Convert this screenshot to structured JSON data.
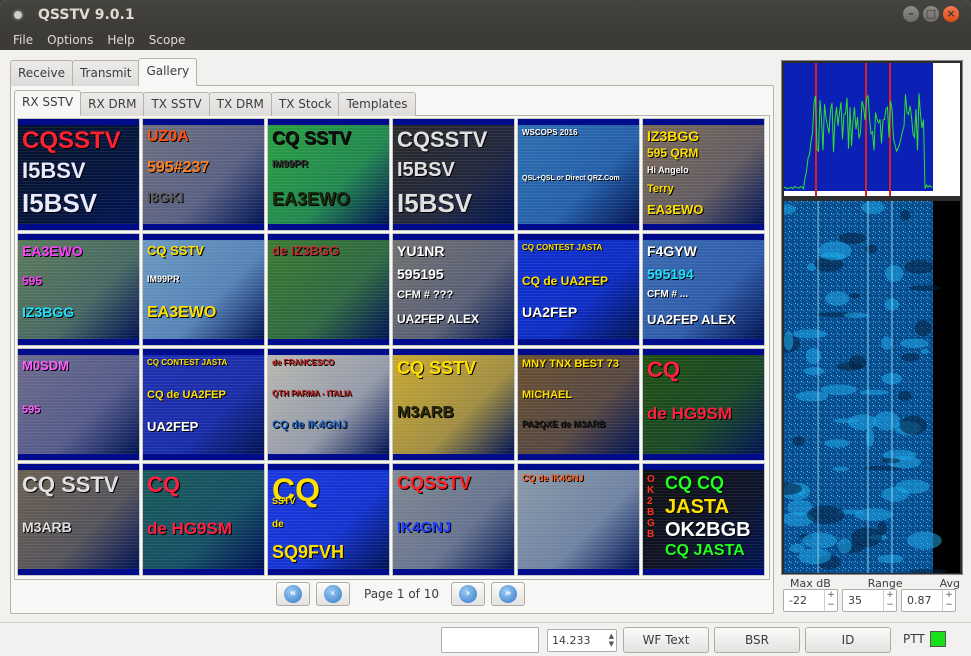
{
  "window": {
    "title": "QSSTV 9.0.1"
  },
  "menu": [
    "File",
    "Options",
    "Help",
    "Scope"
  ],
  "main_tabs": [
    {
      "label": "Receive"
    },
    {
      "label": "Transmit"
    },
    {
      "label": "Gallery",
      "active": true
    }
  ],
  "gallery_tabs": [
    {
      "label": "RX SSTV",
      "active": true
    },
    {
      "label": "RX DRM"
    },
    {
      "label": "TX SSTV"
    },
    {
      "label": "TX DRM"
    },
    {
      "label": "TX Stock"
    },
    {
      "label": "Templates"
    }
  ],
  "thumbnails": [
    {
      "bg": "#06122a",
      "lines": [
        {
          "t": "CQSSTV",
          "c": "#ff2030",
          "s": 24
        },
        {
          "t": "I5BSV",
          "c": "#e8e8ff",
          "s": 22
        },
        {
          "t": "I5BSV",
          "c": "#e8e8ff",
          "s": 26
        }
      ]
    },
    {
      "bg": "#6e7080",
      "lines": [
        {
          "t": "UZ0A",
          "c": "#ff5010",
          "s": 16
        },
        {
          "t": "595#237",
          "c": "#ff8020",
          "s": 16
        },
        {
          "t": "I8GKI",
          "c": "#5a5a5a",
          "s": 14
        }
      ]
    },
    {
      "bg": "#2aa040",
      "lines": [
        {
          "t": "CQ SSTV",
          "c": "#111",
          "s": 18
        },
        {
          "t": "IM99PR",
          "c": "#333",
          "s": 10
        },
        {
          "t": "EA3EWO",
          "c": "#1b2b10",
          "s": 18
        }
      ]
    },
    {
      "bg": "#2a2a2a",
      "lines": [
        {
          "t": "CQSSTV",
          "c": "#e0e0e0",
          "s": 22
        },
        {
          "t": "I5BSV",
          "c": "#e0e0e0",
          "s": 20
        },
        {
          "t": "I5BSV",
          "c": "#e0e0e0",
          "s": 26
        }
      ]
    },
    {
      "bg": "#2e6fb0",
      "lines": [
        {
          "t": "WSCOPS 2016",
          "c": "#fff",
          "s": 8
        },
        {
          "t": "QSL+QSL or Direct QRZ.Com",
          "c": "#fff",
          "s": 7
        }
      ]
    },
    {
      "bg": "#7a6a58",
      "lines": [
        {
          "t": "IZ3BGG",
          "c": "#ffe000",
          "s": 14
        },
        {
          "t": "595 QRM",
          "c": "#ffe000",
          "s": 12
        },
        {
          "t": "Hi Angelo",
          "c": "#fff",
          "s": 9
        },
        {
          "t": "Terry",
          "c": "#ffe000",
          "s": 11
        },
        {
          "t": "EA3EWO",
          "c": "#ffe000",
          "s": 13
        }
      ]
    },
    {
      "bg": "#5a7a5a",
      "lines": [
        {
          "t": "EA3EWO",
          "c": "#ff40ff",
          "s": 14
        },
        {
          "t": "595",
          "c": "#ff40ff",
          "s": 12
        },
        {
          "t": "IZ3BGG",
          "c": "#20e0ff",
          "s": 14
        }
      ]
    },
    {
      "bg": "#6a9ac0",
      "lines": [
        {
          "t": "CQ SSTV",
          "c": "#ffe000",
          "s": 13
        },
        {
          "t": "IM99PR",
          "c": "#fff",
          "s": 9
        },
        {
          "t": "EA3EWO",
          "c": "#ffe000",
          "s": 16
        }
      ]
    },
    {
      "bg": "#3a7a30",
      "lines": [
        {
          "t": "de IZ3BGG",
          "c": "#c03030",
          "s": 13
        }
      ]
    },
    {
      "bg": "#707070",
      "lines": [
        {
          "t": "YU1NR",
          "c": "#fff",
          "s": 14
        },
        {
          "t": "595195",
          "c": "#fff",
          "s": 14
        },
        {
          "t": "CFM # ???",
          "c": "#fff",
          "s": 11
        },
        {
          "t": "UA2FEP  ALEX",
          "c": "#fff",
          "s": 12
        }
      ]
    },
    {
      "bg": "#1030d0",
      "lines": [
        {
          "t": "CQ CONTEST JASTA",
          "c": "#ffe000",
          "s": 8
        },
        {
          "t": "CQ de UA2FEP",
          "c": "#ffe000",
          "s": 12
        },
        {
          "t": "UA2FEP",
          "c": "#fff",
          "s": 14
        }
      ]
    },
    {
      "bg": "#3a6ab0",
      "lines": [
        {
          "t": "F4GYW",
          "c": "#fff",
          "s": 14
        },
        {
          "t": "595194",
          "c": "#20e0ff",
          "s": 14
        },
        {
          "t": "CFM # ...",
          "c": "#fff",
          "s": 10
        },
        {
          "t": "UA2FEP  ALEX",
          "c": "#fff",
          "s": 13
        }
      ]
    },
    {
      "bg": "#6a6a8a",
      "lines": [
        {
          "t": "M0SDM",
          "c": "#ff60ff",
          "s": 13
        },
        {
          "t": "595",
          "c": "#ff60ff",
          "s": 11
        }
      ]
    },
    {
      "bg": "#2030b0",
      "lines": [
        {
          "t": "CQ CONTEST JASTA",
          "c": "#ffe000",
          "s": 8
        },
        {
          "t": "CQ de UA2FEP",
          "c": "#ffe000",
          "s": 11
        },
        {
          "t": "UA2FEP",
          "c": "#fff",
          "s": 13
        }
      ]
    },
    {
      "bg": "#b8b8b0",
      "lines": [
        {
          "t": "de FRANCESCO",
          "c": "#c02020",
          "s": 8
        },
        {
          "t": "QTH PARMA - ITALIA",
          "c": "#c02020",
          "s": 8
        },
        {
          "t": "CQ de IK4GNJ",
          "c": "#2060c0",
          "s": 11
        }
      ]
    },
    {
      "bg": "#c8a830",
      "lines": [
        {
          "t": "CQ SSTV",
          "c": "#ffe000",
          "s": 18
        },
        {
          "t": "M3ARB",
          "c": "#2a2a10",
          "s": 16
        }
      ]
    },
    {
      "bg": "#6a5030",
      "lines": [
        {
          "t": "MNY TNX BEST 73",
          "c": "#ffe000",
          "s": 11
        },
        {
          "t": "MICHAEL",
          "c": "#ffe000",
          "s": 11
        },
        {
          "t": "PA2QXE de M3ARB",
          "c": "#202020",
          "s": 9
        }
      ]
    },
    {
      "bg": "#205010",
      "lines": [
        {
          "t": "CQ",
          "c": "#ff2040",
          "s": 22
        },
        {
          "t": "de HG9SM",
          "c": "#ff2040",
          "s": 17
        }
      ]
    },
    {
      "bg": "#6a6050",
      "lines": [
        {
          "t": "CQ SSTV",
          "c": "#e0e0e0",
          "s": 22
        },
        {
          "t": "M3ARB",
          "c": "#e0e0e0",
          "s": 14
        }
      ]
    },
    {
      "bg": "#1a5a5a",
      "lines": [
        {
          "t": "CQ",
          "c": "#ff2040",
          "s": 22
        },
        {
          "t": "de HG9SM",
          "c": "#ff2040",
          "s": 17
        }
      ]
    },
    {
      "bg": "#1838e0",
      "lines": [
        {
          "t": "CQ",
          "c": "#ffe000",
          "s": 32
        },
        {
          "t": "SSTV",
          "c": "#ffe000",
          "s": 9
        },
        {
          "t": "de",
          "c": "#ffe000",
          "s": 10
        },
        {
          "t": "SQ9FVH",
          "c": "#ffe000",
          "s": 18
        }
      ]
    },
    {
      "bg": "#808890",
      "lines": [
        {
          "t": "CQSSTV",
          "c": "#ff2020",
          "s": 18
        },
        {
          "t": "IK4GNJ",
          "c": "#2040ff",
          "s": 15
        }
      ]
    },
    {
      "bg": "#8a9aa8",
      "lines": [
        {
          "t": "CQ de IK4GNJ",
          "c": "#ff6020",
          "s": 9
        }
      ]
    },
    {
      "bg": "#101010",
      "lines": [
        {
          "t": "CQ CQ",
          "c": "#20ff20",
          "s": 18
        },
        {
          "t": "JASTA",
          "c": "#ffe000",
          "s": 20
        },
        {
          "t": "OK2BGB",
          "c": "#ffffff",
          "s": 20
        },
        {
          "t": "CQ JASTA",
          "c": "#20ff20",
          "s": 16
        }
      ],
      "side": "OK2BGB"
    }
  ],
  "pager": {
    "page_label": "Page 1 of 10",
    "first_icon": "double-left-icon",
    "prev_icon": "left-icon",
    "next_icon": "right-icon",
    "last_icon": "double-right-icon"
  },
  "scope": {
    "max_db_label": "Max  dB",
    "range_label": "Range",
    "avg_label": "Avg",
    "max_db_value": "-22",
    "range_value": "35",
    "avg_value": "0.87"
  },
  "statusbar": {
    "frequency": "14.233",
    "wf_text_label": "WF Text",
    "bsr_label": "BSR",
    "id_label": "ID",
    "ptt_label": "PTT",
    "ptt_color": "#18e018"
  }
}
